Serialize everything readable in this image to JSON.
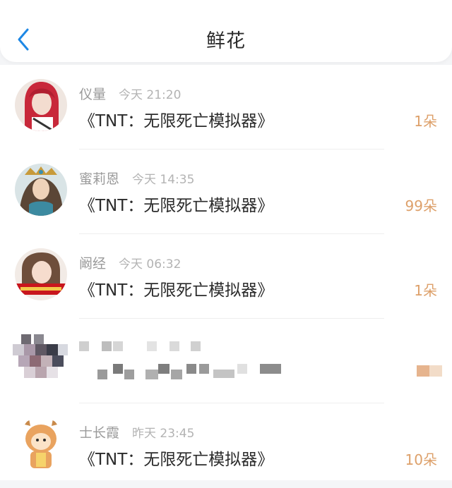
{
  "header": {
    "title": "鲜花",
    "back_icon": "chevron-left-icon",
    "accent": "#1e88e5"
  },
  "count_color": "#dda06a",
  "items": [
    {
      "name": "仪量",
      "time": "今天 21:20",
      "work": "《TNT：无限死亡模拟器》",
      "count": "1朵"
    },
    {
      "name": "蜜莉恩",
      "time": "今天 14:35",
      "work": "《TNT：无限死亡模拟器》",
      "count": "99朵"
    },
    {
      "name": "阚经",
      "time": "今天 06:32",
      "work": "《TNT：无限死亡模拟器》",
      "count": "1朵"
    },
    {
      "name": "士长霞",
      "time": "昨天 23:45",
      "work": "《TNT：无限死亡模拟器》",
      "count": "10朵"
    }
  ]
}
